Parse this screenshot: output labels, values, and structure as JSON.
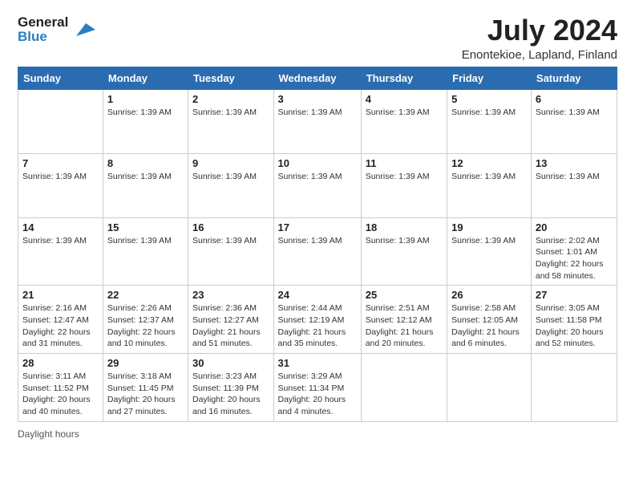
{
  "logo": {
    "line1": "General",
    "line2": "Blue"
  },
  "title": "July 2024",
  "subtitle": "Enontekioe, Lapland, Finland",
  "days_header": [
    "Sunday",
    "Monday",
    "Tuesday",
    "Wednesday",
    "Thursday",
    "Friday",
    "Saturday"
  ],
  "weeks": [
    [
      {
        "day": "",
        "info": ""
      },
      {
        "day": "1",
        "info": "Sunrise: 1:39 AM"
      },
      {
        "day": "2",
        "info": "Sunrise: 1:39 AM"
      },
      {
        "day": "3",
        "info": "Sunrise: 1:39 AM"
      },
      {
        "day": "4",
        "info": "Sunrise: 1:39 AM"
      },
      {
        "day": "5",
        "info": "Sunrise: 1:39 AM"
      },
      {
        "day": "6",
        "info": "Sunrise: 1:39 AM"
      }
    ],
    [
      {
        "day": "7",
        "info": "Sunrise: 1:39 AM"
      },
      {
        "day": "8",
        "info": "Sunrise: 1:39 AM"
      },
      {
        "day": "9",
        "info": "Sunrise: 1:39 AM"
      },
      {
        "day": "10",
        "info": "Sunrise: 1:39 AM"
      },
      {
        "day": "11",
        "info": "Sunrise: 1:39 AM"
      },
      {
        "day": "12",
        "info": "Sunrise: 1:39 AM"
      },
      {
        "day": "13",
        "info": "Sunrise: 1:39 AM"
      }
    ],
    [
      {
        "day": "14",
        "info": "Sunrise: 1:39 AM"
      },
      {
        "day": "15",
        "info": "Sunrise: 1:39 AM"
      },
      {
        "day": "16",
        "info": "Sunrise: 1:39 AM"
      },
      {
        "day": "17",
        "info": "Sunrise: 1:39 AM"
      },
      {
        "day": "18",
        "info": "Sunrise: 1:39 AM"
      },
      {
        "day": "19",
        "info": "Sunrise: 1:39 AM"
      },
      {
        "day": "20",
        "info": "Sunrise: 2:02 AM\nSunset: 1:01 AM\nDaylight: 22 hours and 58 minutes."
      }
    ],
    [
      {
        "day": "21",
        "info": "Sunrise: 2:16 AM\nSunset: 12:47 AM\nDaylight: 22 hours and 31 minutes."
      },
      {
        "day": "22",
        "info": "Sunrise: 2:26 AM\nSunset: 12:37 AM\nDaylight: 22 hours and 10 minutes."
      },
      {
        "day": "23",
        "info": "Sunrise: 2:36 AM\nSunset: 12:27 AM\nDaylight: 21 hours and 51 minutes."
      },
      {
        "day": "24",
        "info": "Sunrise: 2:44 AM\nSunset: 12:19 AM\nDaylight: 21 hours and 35 minutes."
      },
      {
        "day": "25",
        "info": "Sunrise: 2:51 AM\nSunset: 12:12 AM\nDaylight: 21 hours and 20 minutes."
      },
      {
        "day": "26",
        "info": "Sunrise: 2:58 AM\nSunset: 12:05 AM\nDaylight: 21 hours and 6 minutes."
      },
      {
        "day": "27",
        "info": "Sunrise: 3:05 AM\nSunset: 11:58 PM\nDaylight: 20 hours and 52 minutes."
      }
    ],
    [
      {
        "day": "28",
        "info": "Sunrise: 3:11 AM\nSunset: 11:52 PM\nDaylight: 20 hours and 40 minutes."
      },
      {
        "day": "29",
        "info": "Sunrise: 3:18 AM\nSunset: 11:45 PM\nDaylight: 20 hours and 27 minutes."
      },
      {
        "day": "30",
        "info": "Sunrise: 3:23 AM\nSunset: 11:39 PM\nDaylight: 20 hours and 16 minutes."
      },
      {
        "day": "31",
        "info": "Sunrise: 3:29 AM\nSunset: 11:34 PM\nDaylight: 20 hours and 4 minutes."
      },
      {
        "day": "",
        "info": ""
      },
      {
        "day": "",
        "info": ""
      },
      {
        "day": "",
        "info": ""
      }
    ]
  ],
  "footer": {
    "daylight_label": "Daylight hours"
  }
}
